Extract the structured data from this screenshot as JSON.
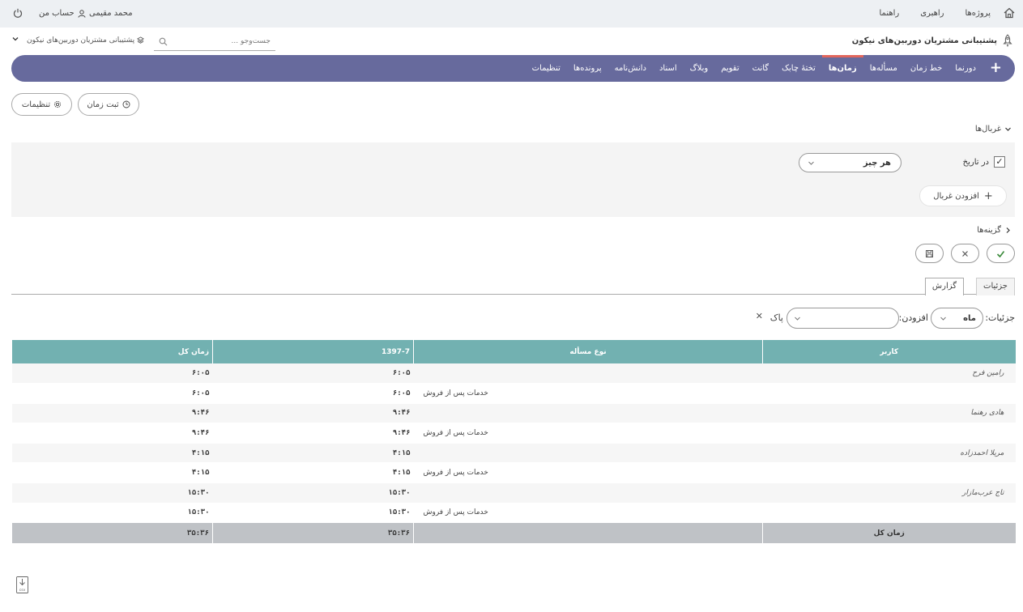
{
  "top_bar": {
    "links": [
      "پروژه‌ها",
      "راهبری",
      "راهنما"
    ],
    "user_name": "محمد مقیمی",
    "my_account": "حساب من"
  },
  "project_bar": {
    "title": "پشتیبانی مشتریان دوربین‌های نیکون",
    "search_placeholder": "جست‌وجو ...",
    "jump_label": "پشتیبانی مشتریان دوربین‌های نیکون"
  },
  "main_nav": {
    "items": [
      "دورنما",
      "خط زمان",
      "مسأله‌ها",
      "زمان‌ها",
      "تختهٔ چابک",
      "گانت",
      "تقویم",
      "وبلاگ",
      "اسناد",
      "دانش‌نامه",
      "پرونده‌ها",
      "تنظیمات"
    ],
    "active": "زمان‌ها"
  },
  "actions": {
    "log_time": "ثبت زمان",
    "settings": "تنظیمات"
  },
  "filters": {
    "title": "غربال‌ها",
    "date_label": "در تاریخ",
    "date_value": "هر چیز",
    "add_filter": "افزودن غربال"
  },
  "options": {
    "title": "گزینه‌ها"
  },
  "tabs": {
    "details": "جزئیات",
    "report": "گزارش"
  },
  "report_options": {
    "details_label": "جزئیات:",
    "details_value": "ماه",
    "add_label": "افزودن:",
    "clear": "پاک"
  },
  "table": {
    "headers": {
      "user": "کاربر",
      "issue_type": "نوع مسأله",
      "month": "1397-7",
      "total": "زمان کل"
    },
    "groups": [
      {
        "user": "رامین فرح",
        "month": "۶:۰۵",
        "total": "۶:۰۵",
        "sub_type": "خدمات پس از فروش",
        "sub_month": "۶:۰۵",
        "sub_total": "۶:۰۵"
      },
      {
        "user": "هادی رهنما",
        "month": "۹:۴۶",
        "total": "۹:۴۶",
        "sub_type": "خدمات پس از فروش",
        "sub_month": "۹:۴۶",
        "sub_total": "۹:۴۶"
      },
      {
        "user": "مریلا احمدزاده",
        "month": "۴:۱۵",
        "total": "۴:۱۵",
        "sub_type": "خدمات پس از فروش",
        "sub_month": "۴:۱۵",
        "sub_total": "۴:۱۵"
      },
      {
        "user": "تاج عرب‌مازار",
        "month": "۱۵:۳۰",
        "total": "۱۵:۳۰",
        "sub_type": "خدمات پس از فروش",
        "sub_month": "۱۵:۳۰",
        "sub_total": "۱۵:۳۰"
      }
    ],
    "footer": {
      "label": "زمان کل",
      "month": "۳۵:۳۶",
      "total": "۳۵:۳۶"
    }
  },
  "export": {
    "csv": "csv"
  }
}
